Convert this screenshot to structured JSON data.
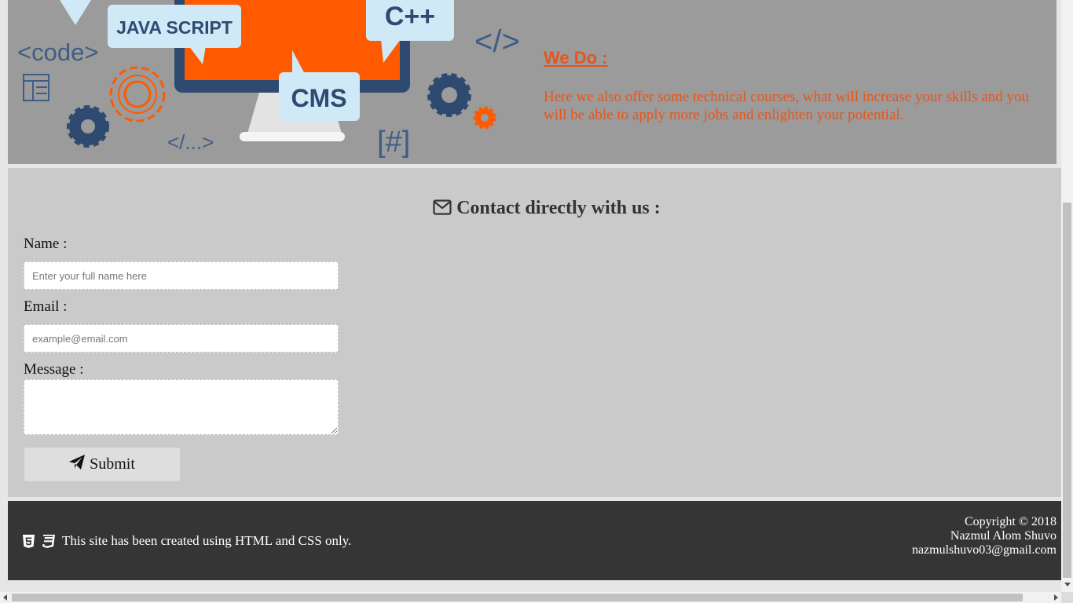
{
  "banner": {
    "illustration": {
      "bubble_js": "JAVA SCRIPT",
      "bubble_cpp": "C++",
      "bubble_cms": "CMS",
      "code_tag": "<code>",
      "close_tag": "</>",
      "ellipsis_tag": "</...>",
      "hash_tag": "[#]",
      "accent_color": "#ff5a00",
      "dark_color": "#2e4a70"
    },
    "title": "We Do :",
    "text": "Here we also offer some technical courses, what will increase your skills and you will be able to apply more jobs and enlighten your potential."
  },
  "contact": {
    "title": "Contact directly with us :",
    "title_icon": "envelope-icon",
    "name_label": "Name :",
    "name_placeholder": "Enter your full name here",
    "email_label": "Email :",
    "email_placeholder": "example@email.com",
    "message_label": "Message :",
    "message_value": "",
    "submit_label": "Submit",
    "submit_icon": "paper-plane-icon"
  },
  "footer": {
    "left_icons": [
      "html5-icon",
      "css3-icon"
    ],
    "left_text": "This site has been created using HTML and CSS only.",
    "copyright": "Copyright © 2018",
    "author": "Nazmul Alom Shuvo",
    "email": "nazmulshuvo03@gmail.com"
  },
  "colors": {
    "banner_bg": "#9b9b9b",
    "accent": "#e4561c",
    "contact_bg": "#cacaca",
    "footer_bg": "#353535"
  }
}
